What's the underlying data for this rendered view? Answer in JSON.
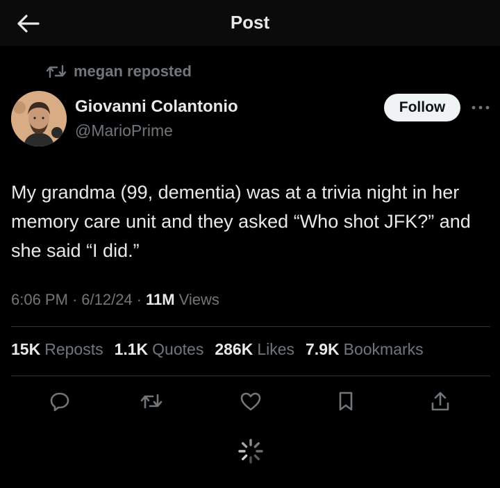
{
  "header": {
    "title": "Post",
    "back_icon": "arrow-left-icon"
  },
  "repost": {
    "icon": "repost-icon",
    "label": "megan reposted"
  },
  "author": {
    "name": "Giovanni Colantonio",
    "handle": "@MarioPrime",
    "avatar_icon": "avatar"
  },
  "follow": {
    "label": "Follow"
  },
  "more_icon": "more-horizontal-icon",
  "tweet": {
    "text": "My grandma (99, dementia) was at a trivia night in her memory care unit and they asked “Who shot JFK?” and she said “I did.”"
  },
  "meta": {
    "time": "6:06 PM",
    "date": "6/12/24",
    "views_count": "11M",
    "views_label": "Views",
    "separator": "·"
  },
  "stats": [
    {
      "count": "15K",
      "label": "Reposts"
    },
    {
      "count": "1.1K",
      "label": "Quotes"
    },
    {
      "count": "286K",
      "label": "Likes"
    },
    {
      "count": "7.9K",
      "label": "Bookmarks"
    }
  ],
  "actions": [
    "reply-icon",
    "repost-icon",
    "like-icon",
    "bookmark-icon",
    "share-icon"
  ],
  "colors": {
    "background": "#000000",
    "text_primary": "#e7e9ea",
    "text_secondary": "#71767b",
    "divider": "#2f3336",
    "follow_bg": "#eff3f4"
  }
}
